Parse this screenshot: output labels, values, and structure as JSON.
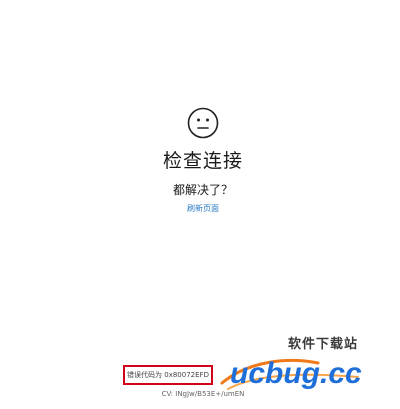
{
  "icon": "neutral-face-icon",
  "title": "检查连接",
  "question": "都解决了？",
  "refresh_label": "刷新页面",
  "error_code_text": "错误代码为 0x80072EFD",
  "cv_text": "CV: INgJw/B53E+/umEN",
  "watermark": {
    "top_text": "软件下载站",
    "logo_text": "ucbug.cc"
  },
  "colors": {
    "link": "#2a7ac4",
    "error_border": "#d0021b",
    "watermark_orange": "#f07a1a",
    "watermark_blue": "#1e6fd9"
  }
}
